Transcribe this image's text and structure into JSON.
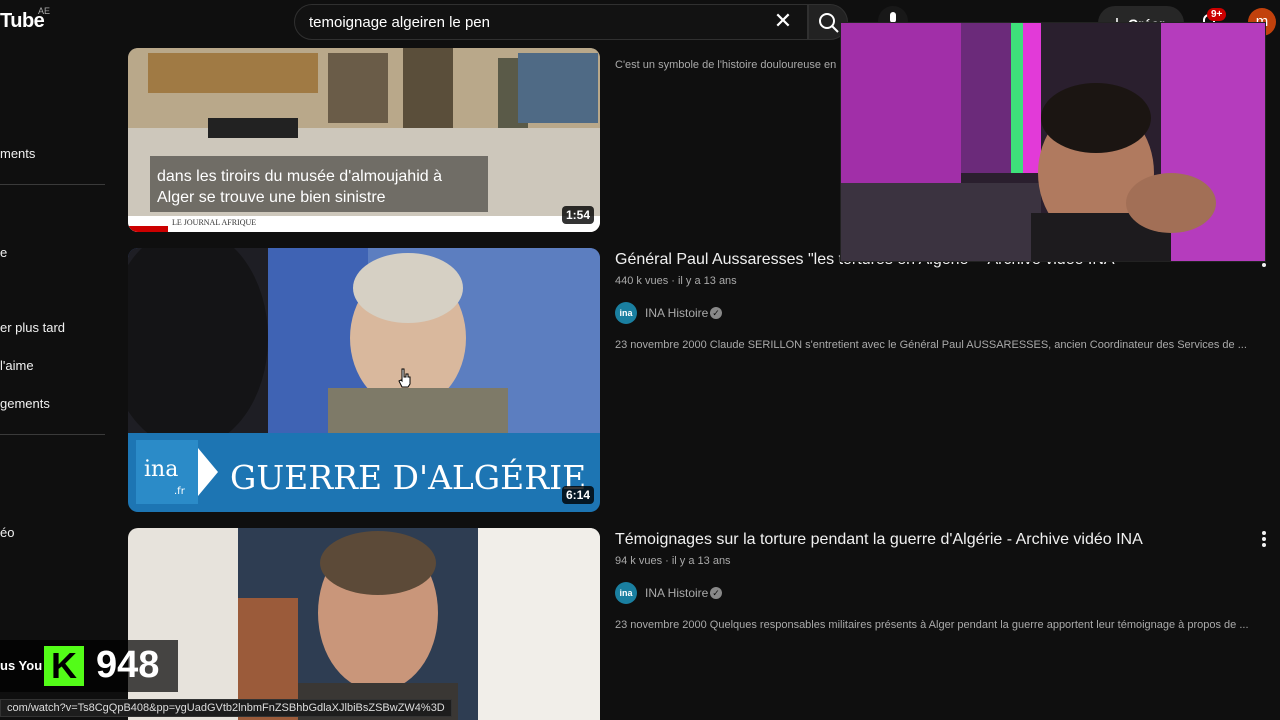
{
  "header": {
    "logo": "Tube",
    "logo_region": "AE",
    "search_query": "temoignage algeiren le pen",
    "create_label": "Créer",
    "notif_count": "9+",
    "avatar_letter": "m"
  },
  "sidebar": {
    "items": [
      "ments",
      "e",
      "er plus tard",
      "l'aime",
      "gements",
      "éo",
      "us You"
    ]
  },
  "results": [
    {
      "thumb_caption": "dans les tiroirs du musée d'almoujahid à Alger se trouve une bien sinistre",
      "thumb_footer": "LE JOURNAL AFRIQUE",
      "duration": "1:54",
      "description": "C'est un symbole de l'histoire douloureuse en"
    },
    {
      "title": "Général Paul Aussaresses \"les tortures en Algérie\" - Archive vidéo INA",
      "meta": "440 k vues · il y a 13 ans",
      "channel": "INA Histoire",
      "description": "23 novembre 2000 Claude SERILLON s'entretient avec le Général Paul AUSSARESSES, ancien Coordinateur des Services de ...",
      "thumb_banner_logo": "ina",
      "thumb_banner_logo_sub": ".fr",
      "thumb_banner_text": "GUERRE D'ALGÉRIE",
      "duration": "6:14"
    },
    {
      "title": "Témoignages sur la torture pendant la guerre d'Algérie - Archive vidéo INA",
      "meta": "94 k vues · il y a 13 ans",
      "channel": "INA Histoire",
      "description": "23 novembre 2000 Quelques responsables militaires présents à Alger pendant la guerre apportent leur témoignage à propos de ..."
    }
  ],
  "overlay": {
    "kick_logo": "K",
    "kick_count": "948",
    "status_url": "com/watch?v=Ts8CgQpB408&pp=ygUadGVtb2lnbmFnZSBhbGdlaXJlbiBsZSBwZW4%3D"
  },
  "colors": {
    "background": "#0f0f0f",
    "accent_red": "#cc0000",
    "kick_green": "#53fc18",
    "ina_blue": "#1a7fa0"
  }
}
